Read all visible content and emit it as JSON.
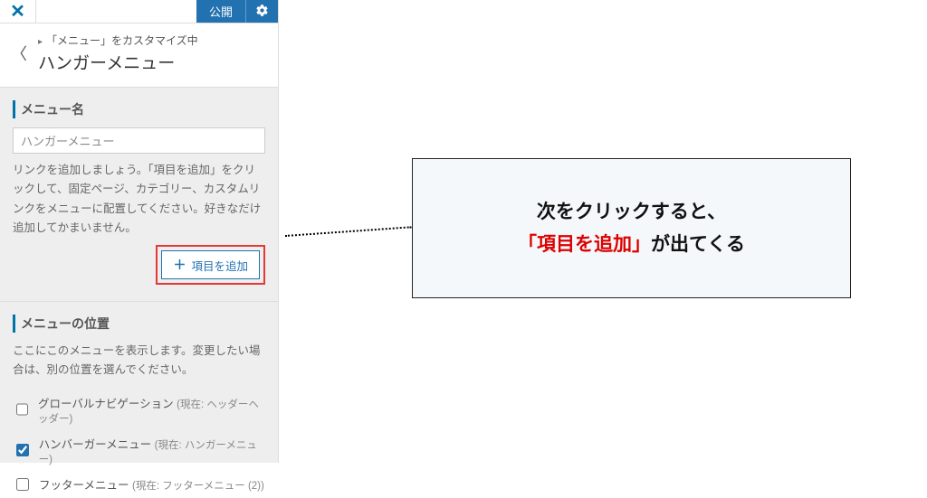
{
  "topbar": {
    "publish": "公開"
  },
  "header": {
    "breadcrumb": "「メニュー」をカスタマイズ中",
    "title": "ハンガーメニュー"
  },
  "menu_name": {
    "label": "メニュー名",
    "value": "ハンガーメニュー",
    "help": "リンクを追加しましょう。「項目を追加」をクリックして、固定ページ、カテゴリー、カスタムリンクをメニューに配置してください。好きなだけ追加してかまいません。",
    "add_button": "項目を追加"
  },
  "location": {
    "label": "メニューの位置",
    "help": "ここにこのメニューを表示します。変更したい場合は、別の位置を選んでください。",
    "items": [
      {
        "label": "グローバルナビゲーション",
        "sub": "(現在: ヘッダーヘッダー)",
        "checked": false
      },
      {
        "label": "ハンバーガーメニュー",
        "sub": "(現在: ハンガーメニュー)",
        "checked": true
      },
      {
        "label": "フッターメニュー",
        "sub": "(現在: フッターメニュー (2))",
        "checked": false
      }
    ]
  },
  "callout": {
    "line1": "次をクリックすると、",
    "line2a": "「項目を追加」",
    "line2b": "が出てくる"
  }
}
